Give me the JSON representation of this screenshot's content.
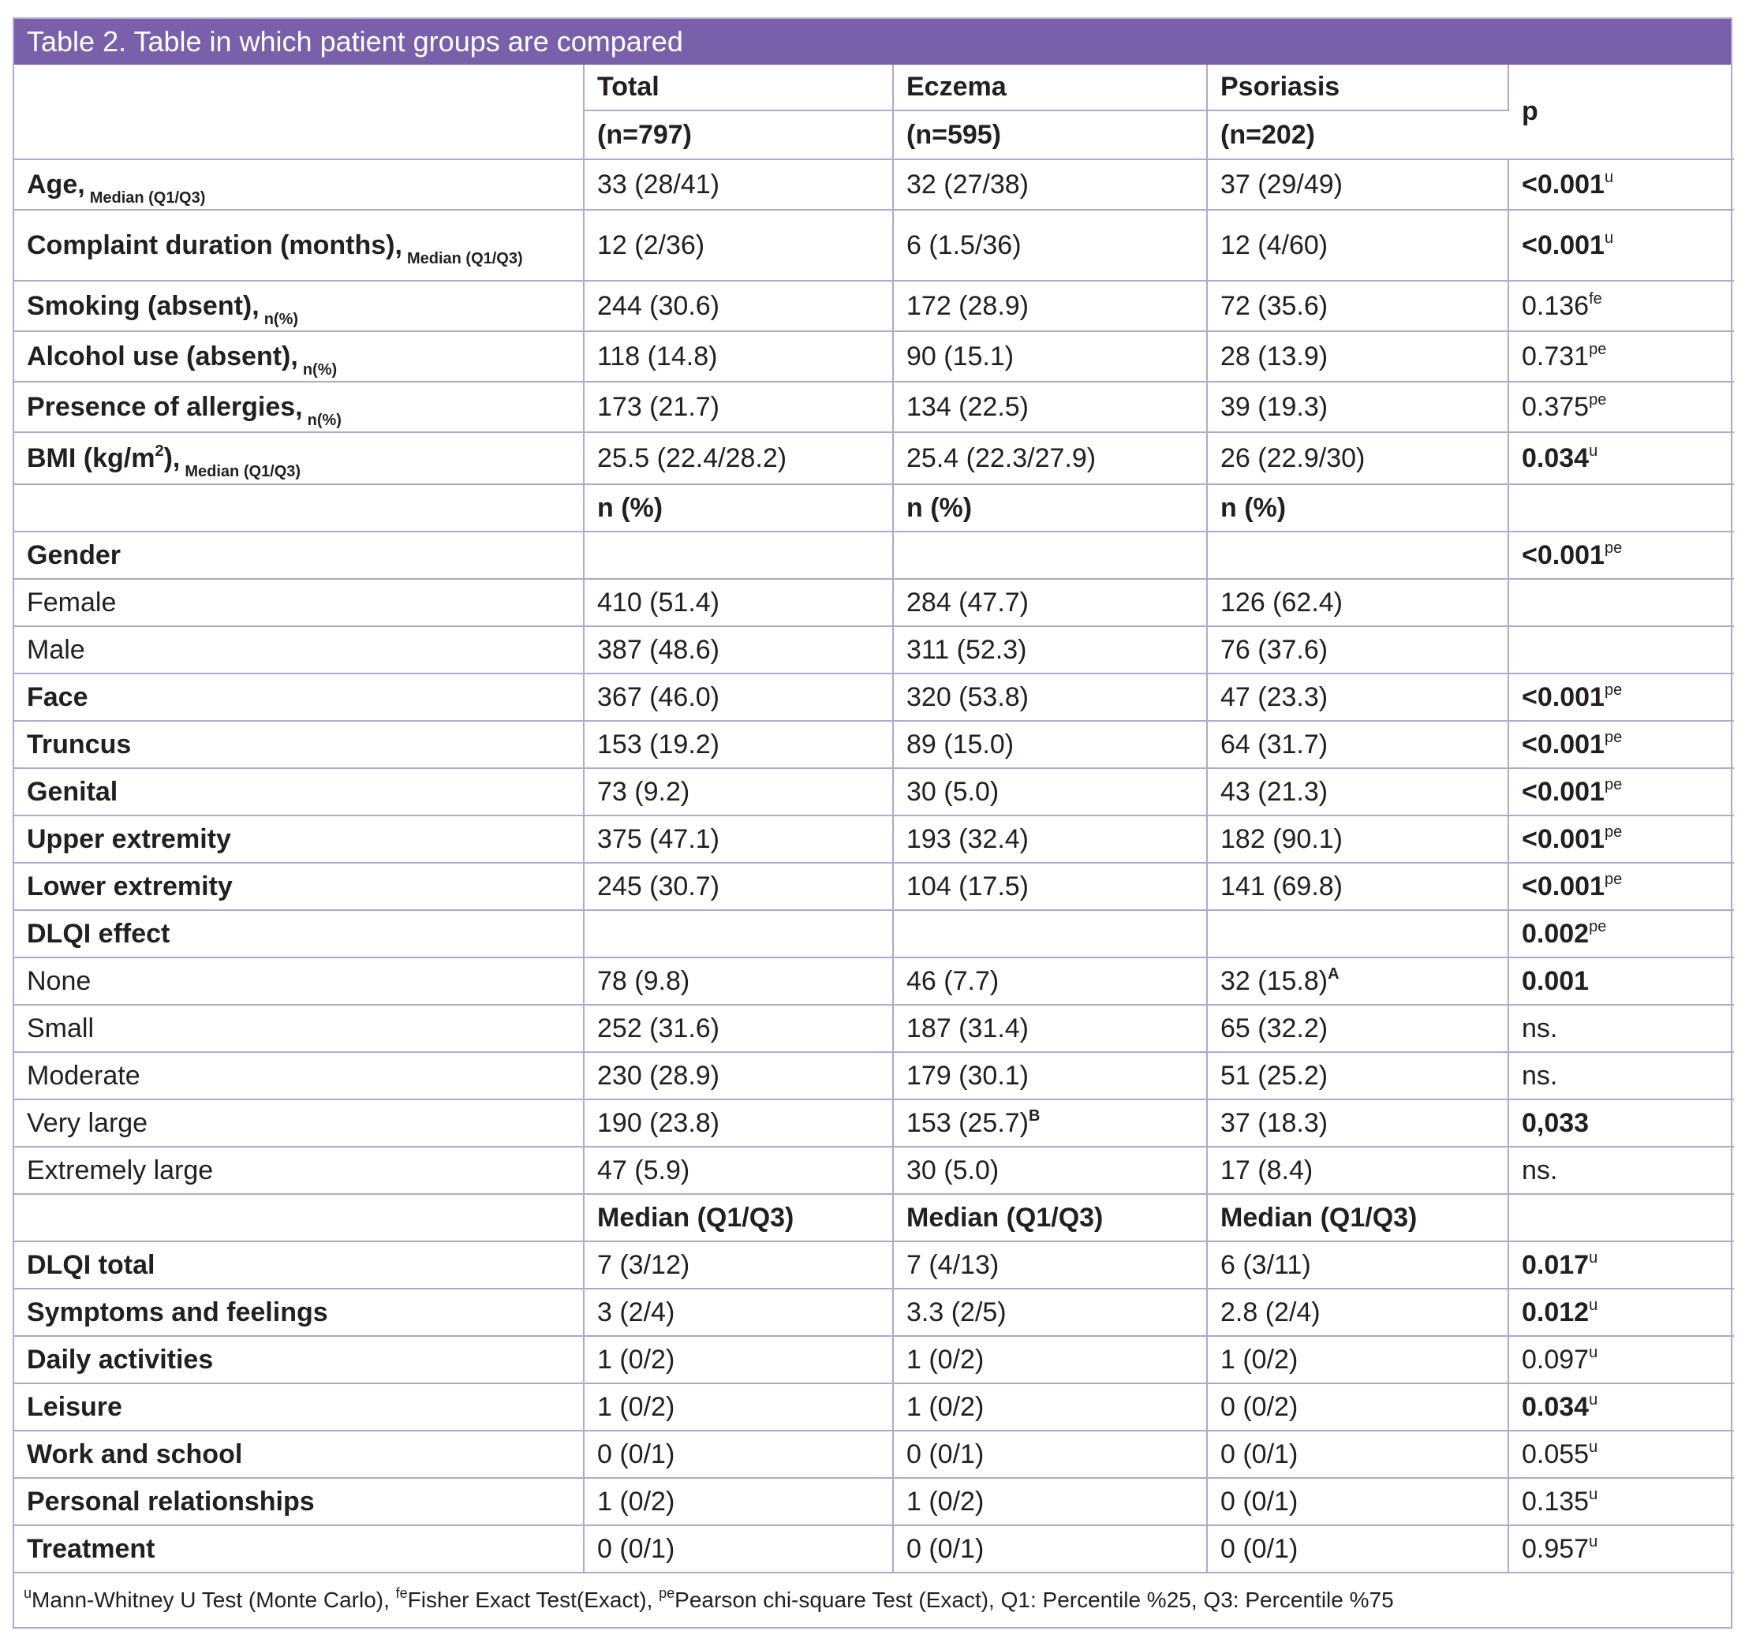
{
  "title": "Table 2. Table in which patient groups are compared",
  "header": {
    "total": "Total",
    "total_n": "(n=797)",
    "eczema": "Eczema",
    "eczema_n": "(n=595)",
    "psoriasis": "Psoriasis",
    "psoriasis_n": "(n=202)",
    "p": "p"
  },
  "rows_a": [
    {
      "label": "Age,",
      "sub": "Median (Q1/Q3)",
      "total": "33 (28/41)",
      "eczema": "32 (27/38)",
      "psoriasis": "37 (29/49)",
      "p": "<0.001",
      "sup": "u",
      "bold_p": true
    },
    {
      "label": "Complaint duration (months),",
      "sub": "Median (Q1/Q3)",
      "total": "12 (2/36)",
      "eczema": "6 (1.5/36)",
      "psoriasis": "12 (4/60)",
      "p": "<0.001",
      "sup": "u",
      "bold_p": true
    },
    {
      "label": "Smoking (absent),",
      "sub": "n(%)",
      "total": "244 (30.6)",
      "eczema": "172 (28.9)",
      "psoriasis": "72 (35.6)",
      "p": "0.136",
      "sup": "fe",
      "bold_p": false
    },
    {
      "label": "Alcohol use (absent),",
      "sub": "n(%)",
      "total": "118 (14.8)",
      "eczema": "90 (15.1)",
      "psoriasis": "28 (13.9)",
      "p": "0.731",
      "sup": "pe",
      "bold_p": false
    },
    {
      "label": "Presence of allergies,",
      "sub": "n(%)",
      "total": "173 (21.7)",
      "eczema": "134 (22.5)",
      "psoriasis": "39 (19.3)",
      "p": "0.375",
      "sup": "pe",
      "bold_p": false
    },
    {
      "label": "BMI (kg/m",
      "label_sup": "2",
      "label_after": "),",
      "sub": "Median (Q1/Q3)",
      "total": "25.5 (22.4/28.2)",
      "eczema": "25.4 (22.3/27.9)",
      "psoriasis": "26 (22.9/30)",
      "p": "0.034",
      "sup": "u",
      "bold_p": true
    }
  ],
  "npct": "n (%)",
  "rows_b": [
    {
      "label": "Gender",
      "bold": true,
      "total": "",
      "eczema": "",
      "psoriasis": "",
      "p": "<0.001",
      "sup": "pe",
      "bold_p": true
    },
    {
      "label": "Female",
      "bold": false,
      "total": "410 (51.4)",
      "eczema": "284 (47.7)",
      "psoriasis": "126 (62.4)",
      "p": "",
      "sup": "",
      "bold_p": false
    },
    {
      "label": "Male",
      "bold": false,
      "total": "387 (48.6)",
      "eczema": "311 (52.3)",
      "psoriasis": "76 (37.6)",
      "p": "",
      "sup": "",
      "bold_p": false
    },
    {
      "label": "Face",
      "bold": true,
      "total": "367 (46.0)",
      "eczema": "320 (53.8)",
      "psoriasis": "47 (23.3)",
      "p": "<0.001",
      "sup": "pe",
      "bold_p": true
    },
    {
      "label": "Truncus",
      "bold": true,
      "total": "153 (19.2)",
      "eczema": "89 (15.0)",
      "psoriasis": "64 (31.7)",
      "p": "<0.001",
      "sup": "pe",
      "bold_p": true
    },
    {
      "label": "Genital",
      "bold": true,
      "total": "73 (9.2)",
      "eczema": "30 (5.0)",
      "psoriasis": "43 (21.3)",
      "p": "<0.001",
      "sup": "pe",
      "bold_p": true
    },
    {
      "label": "Upper extremity",
      "bold": true,
      "total": "375 (47.1)",
      "eczema": "193 (32.4)",
      "psoriasis": "182 (90.1)",
      "p": "<0.001",
      "sup": "pe",
      "bold_p": true
    },
    {
      "label": "Lower extremity",
      "bold": true,
      "total": "245 (30.7)",
      "eczema": "104 (17.5)",
      "psoriasis": "141 (69.8)",
      "p": "<0.001",
      "sup": "pe",
      "bold_p": true
    },
    {
      "label": "DLQI effect",
      "bold": true,
      "total": "",
      "eczema": "",
      "psoriasis": "",
      "p": "0.002",
      "sup": "pe",
      "bold_p": true
    },
    {
      "label": "None",
      "bold": false,
      "total": "78 (9.8)",
      "eczema": "46 (7.7)",
      "psoriasis": "32 (15.8)",
      "psoriasis_sup": "A",
      "p": "0.001",
      "sup": "",
      "bold_p": true
    },
    {
      "label": "Small",
      "bold": false,
      "total": "252 (31.6)",
      "eczema": "187 (31.4)",
      "psoriasis": "65 (32.2)",
      "p": "ns.",
      "sup": "",
      "bold_p": false
    },
    {
      "label": "Moderate",
      "bold": false,
      "total": "230 (28.9)",
      "eczema": "179 (30.1)",
      "psoriasis": "51 (25.2)",
      "p": "ns.",
      "sup": "",
      "bold_p": false
    },
    {
      "label": "Very large",
      "bold": false,
      "total": "190 (23.8)",
      "eczema": "153 (25.7)",
      "eczema_sup": "B",
      "psoriasis": "37 (18.3)",
      "p": "0,033",
      "sup": "",
      "bold_p": true
    },
    {
      "label": "Extremely large",
      "bold": false,
      "total": "47 (5.9)",
      "eczema": "30 (5.0)",
      "psoriasis": "17 (8.4)",
      "p": "ns.",
      "sup": "",
      "bold_p": false
    }
  ],
  "median_label": "Median (Q1/Q3)",
  "rows_c": [
    {
      "label": "DLQI total",
      "total": "7 (3/12)",
      "eczema": "7 (4/13)",
      "psoriasis": "6 (3/11)",
      "p": "0.017",
      "sup": "u",
      "bold_p": true
    },
    {
      "label": "Symptoms and feelings",
      "total": "3 (2/4)",
      "eczema": "3.3 (2/5)",
      "psoriasis": "2.8 (2/4)",
      "p": "0.012",
      "sup": "u",
      "bold_p": true
    },
    {
      "label": "Daily activities",
      "total": "1 (0/2)",
      "eczema": "1 (0/2)",
      "psoriasis": "1 (0/2)",
      "p": "0.097",
      "sup": "u",
      "bold_p": false
    },
    {
      "label": "Leisure",
      "total": "1 (0/2)",
      "eczema": "1 (0/2)",
      "psoriasis": "0 (0/2)",
      "p": "0.034",
      "sup": "u",
      "bold_p": true
    },
    {
      "label": "Work and school",
      "total": "0 (0/1)",
      "eczema": "0 (0/1)",
      "psoriasis": "0 (0/1)",
      "p": "0.055",
      "sup": "u",
      "bold_p": false
    },
    {
      "label": "Personal relationships",
      "total": "1 (0/2)",
      "eczema": "1 (0/2)",
      "psoriasis": "0 (0/1)",
      "p": "0.135",
      "sup": "u",
      "bold_p": false
    },
    {
      "label": "Treatment",
      "total": "0 (0/1)",
      "eczema": "0 (0/1)",
      "psoriasis": "0 (0/1)",
      "p": "0.957",
      "sup": "u",
      "bold_p": false
    }
  ],
  "footnote": {
    "u_sup": "u",
    "u_text": "Mann-Whitney U Test (Monte Carlo),",
    "fe_sup": "fe",
    "fe_text": "Fisher Exact Test(Exact),",
    "pe_sup": "pe",
    "pe_text": "Pearson chi-square Test (Exact), Q1: Percentile %25, Q3: Percentile %75"
  }
}
